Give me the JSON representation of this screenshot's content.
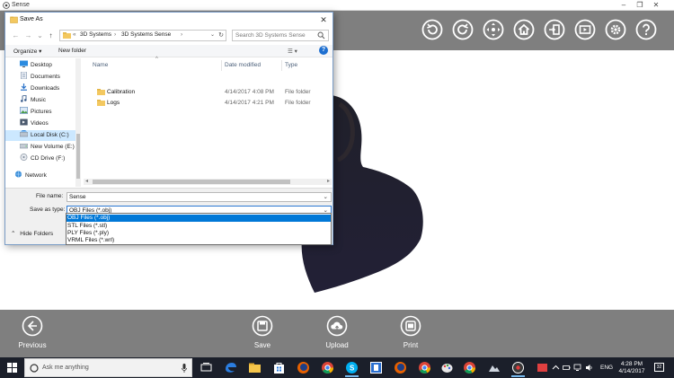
{
  "app": {
    "title": "Sense",
    "window_controls": [
      "–",
      "❐",
      "✕"
    ],
    "toolbar_icons": [
      "undo-icon",
      "redo-icon",
      "move-icon",
      "home-icon",
      "exit-icon",
      "play-video-icon",
      "settings-icon",
      "help-icon"
    ],
    "bottom_bar": {
      "previous_label": "Previous",
      "save_label": "Save",
      "upload_label": "Upload",
      "print_label": "Print"
    },
    "colors": {
      "toolbar_bg": "#7f7f7f",
      "icon": "#ffffff"
    }
  },
  "dialog": {
    "title": "Save As",
    "close_glyph": "✕",
    "nav_glyphs": {
      "back": "←",
      "forward": "→",
      "history": "⌄",
      "up": "↑"
    },
    "address": {
      "prefix": "«",
      "crumbs": [
        "3D Systems",
        "3D Systems Sense"
      ],
      "separator": "›",
      "dropdown_glyph": "⌄",
      "refresh_glyph": "↻"
    },
    "search_placeholder": "Search 3D Systems Sense",
    "commands": {
      "organize": "Organize ▾",
      "new_folder": "New folder",
      "view_glyph": "☰ ▾",
      "help_glyph": "?"
    },
    "nav_items": [
      {
        "label": "Desktop",
        "icon": "desktop-icon",
        "selected": false
      },
      {
        "label": "Documents",
        "icon": "documents-icon",
        "selected": false
      },
      {
        "label": "Downloads",
        "icon": "downloads-icon",
        "selected": false
      },
      {
        "label": "Music",
        "icon": "music-icon",
        "selected": false
      },
      {
        "label": "Pictures",
        "icon": "pictures-icon",
        "selected": false
      },
      {
        "label": "Videos",
        "icon": "videos-icon",
        "selected": false
      },
      {
        "label": "Local Disk (C:)",
        "icon": "local-disk-icon",
        "selected": true
      },
      {
        "label": "New Volume (E:)",
        "icon": "drive-icon",
        "selected": false
      },
      {
        "label": "CD Drive (F:)",
        "icon": "cd-drive-icon",
        "selected": false
      },
      {
        "label": "Network",
        "icon": "network-icon",
        "selected": false
      }
    ],
    "columns": {
      "name": "Name",
      "date": "Date modified",
      "type": "Type",
      "sort_glyph": "^"
    },
    "files": [
      {
        "name": "Calibration",
        "date": "4/14/2017 4:08 PM",
        "type": "File folder"
      },
      {
        "name": "Logs",
        "date": "4/14/2017 4:21 PM",
        "type": "File folder"
      }
    ],
    "scroll_glyphs": {
      "left": "◂",
      "right": "▸"
    },
    "form": {
      "filename_label": "File name:",
      "filename_value": "Sense",
      "savetype_label": "Save as type:",
      "savetype_value": "OBJ Files (*.obj)",
      "dropdown_glyph": "⌄"
    },
    "hide_folders_label": "Hide Folders",
    "hide_folders_glyph": "⌃",
    "type_options": [
      {
        "label": "OBJ Files (*.obj)",
        "selected": true
      },
      {
        "label": "STL Files (*.stl)",
        "selected": false
      },
      {
        "label": "PLY Files (*.ply)",
        "selected": false
      },
      {
        "label": "VRML Files (*.wrl)",
        "selected": false
      }
    ]
  },
  "taskbar": {
    "search_placeholder": "Ask me anything",
    "language": "ENG",
    "time": "4:28 PM",
    "date": "4/14/2017",
    "notification_count": "32",
    "apps": [
      "task-view-icon",
      "edge-icon",
      "file-explorer-icon",
      "store-icon",
      "firefox-icon",
      "chrome-icon",
      "skype-icon",
      "app-icon",
      "firefox-icon",
      "chrome-icon",
      "paint-icon",
      "chrome-icon",
      "photos-icon",
      "sense-icon",
      "app-icon"
    ]
  }
}
